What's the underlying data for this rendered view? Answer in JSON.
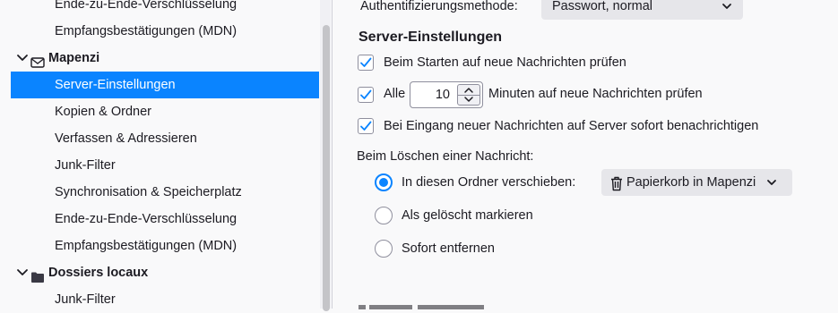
{
  "sidebar": {
    "items": [
      {
        "label": "Ende-zu-Ende-Verschlüsselung"
      },
      {
        "label": "Empfangsbestätigungen (MDN)"
      },
      {
        "label": "Mapenzi"
      },
      {
        "label": "Server-Einstellungen"
      },
      {
        "label": "Kopien & Ordner"
      },
      {
        "label": "Verfassen & Adressieren"
      },
      {
        "label": "Junk-Filter"
      },
      {
        "label": "Synchronisation & Speicherplatz"
      },
      {
        "label": "Ende-zu-Ende-Verschlüsselung"
      },
      {
        "label": "Empfangsbestätigungen (MDN)"
      },
      {
        "label": "Dossiers locaux"
      },
      {
        "label": "Junk-Filter"
      }
    ]
  },
  "main": {
    "auth_label": "Authentifizierungsmethode:",
    "auth_value": "Passwort, normal",
    "server_heading": "Server-Einstellungen",
    "check_start_label": "Beim Starten auf neue Nachrichten prüfen",
    "check_every_prefix": "Alle",
    "check_every_minutes": "10",
    "check_every_suffix": "Minuten auf neue Nachrichten prüfen",
    "notify_label": "Bei Eingang neuer Nachrichten auf Server sofort benachrichtigen",
    "delete_heading": "Beim Löschen einer Nachricht:",
    "move_label": "In diesen Ordner verschieben:",
    "folder_button": "Papierkorb in Mapenzi",
    "mark_deleted_label": "Als gelöscht markieren",
    "remove_now_label": "Sofort entfernen"
  },
  "colors": {
    "accent": "#0a84ff",
    "sidebar_bg": "#f9f9fa",
    "button_bg": "#e6e6ea"
  }
}
